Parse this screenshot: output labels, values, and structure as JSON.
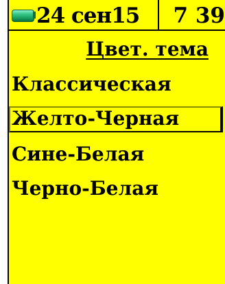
{
  "status_bar": {
    "battery_icon": "battery-icon",
    "date": "24 сен15",
    "time": "7 39"
  },
  "screen": {
    "title": "Цвет. тема",
    "items": [
      {
        "label": "Классическая",
        "selected": false
      },
      {
        "label": "Желто-Черная",
        "selected": true
      },
      {
        "label": "Сине-Белая",
        "selected": false
      },
      {
        "label": "Черно-Белая",
        "selected": false
      }
    ]
  },
  "colors": {
    "background": "#ffff00",
    "text": "#000000",
    "battery": "#18a060"
  }
}
